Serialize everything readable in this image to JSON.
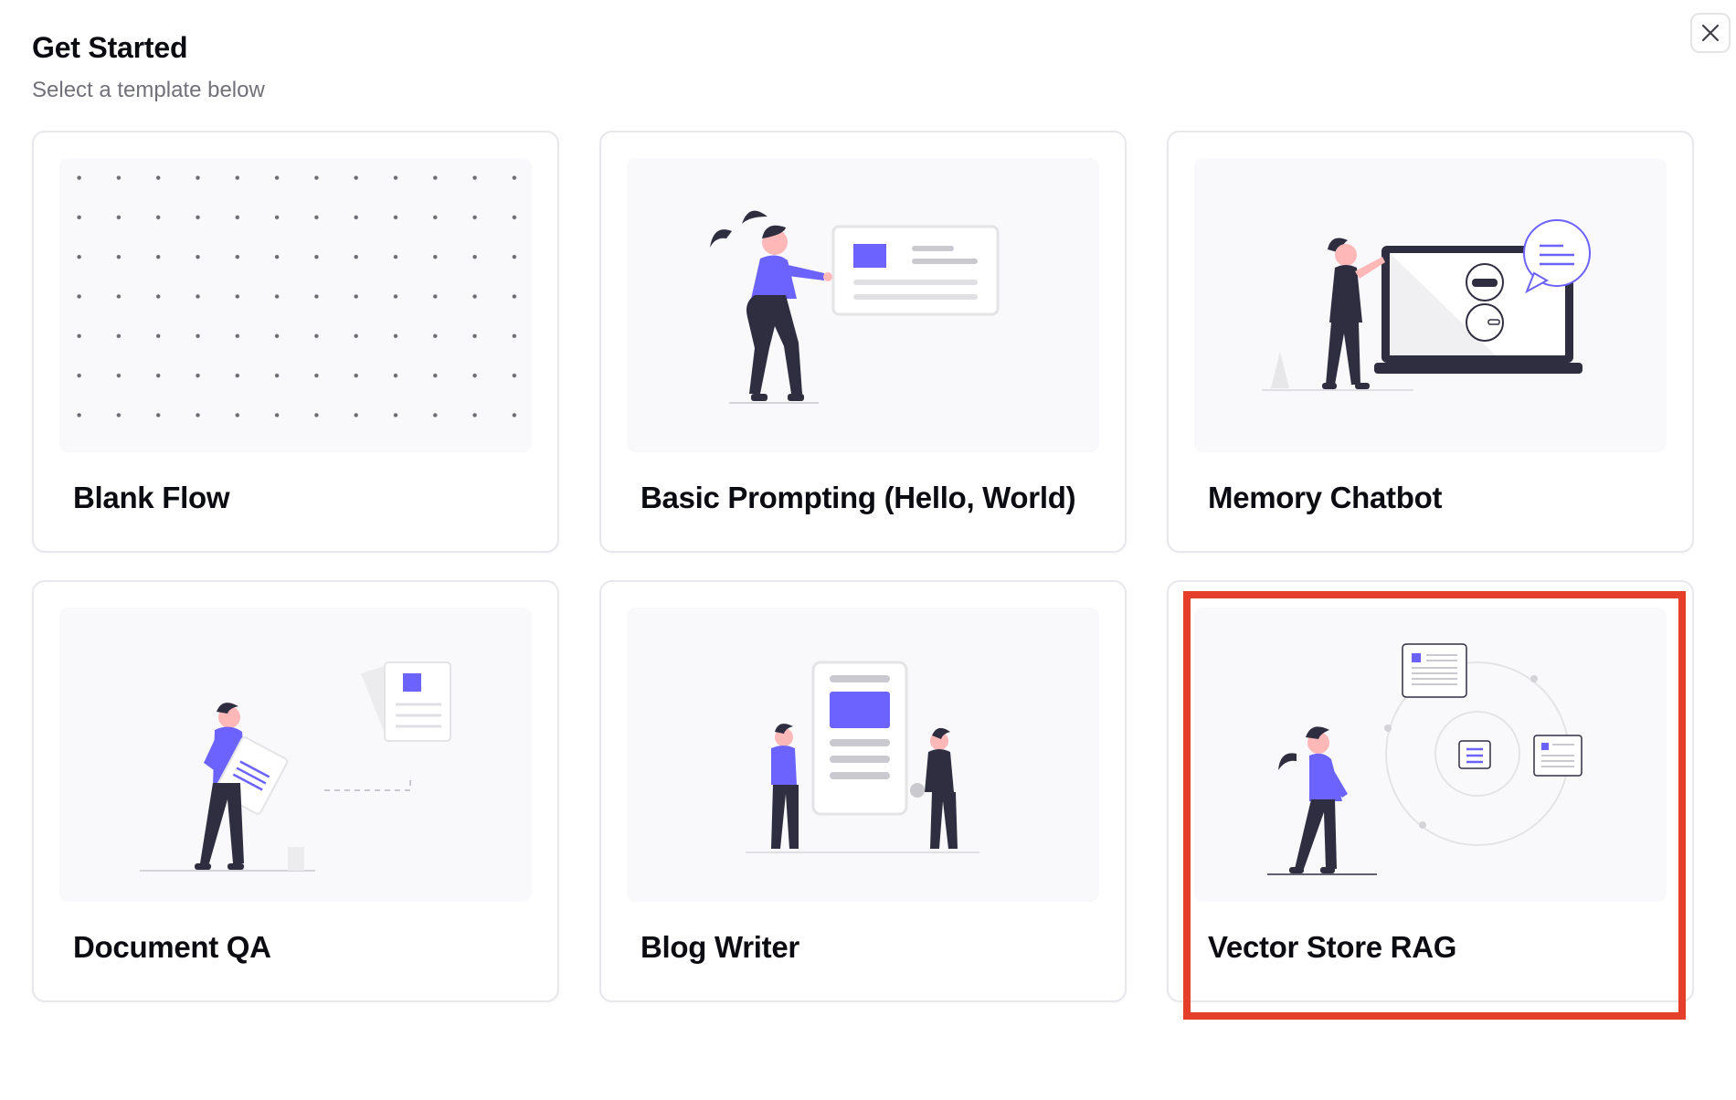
{
  "header": {
    "title": "Get Started",
    "subtitle": "Select a template below"
  },
  "close_button": {
    "icon": "close-icon"
  },
  "templates": [
    {
      "label": "Blank Flow",
      "illustration": "dot-grid"
    },
    {
      "label": "Basic Prompting (Hello, World)",
      "illustration": "person-presenting-card"
    },
    {
      "label": "Memory Chatbot",
      "illustration": "person-laptop-robot-chat"
    },
    {
      "label": "Document QA",
      "illustration": "person-holding-document"
    },
    {
      "label": "Blog Writer",
      "illustration": "two-people-article"
    },
    {
      "label": "Vector Store RAG",
      "illustration": "person-orbit-documents"
    }
  ],
  "colors": {
    "accent": "#6c63ff",
    "dark": "#2f2e41",
    "highlight": "#e53e2b"
  }
}
